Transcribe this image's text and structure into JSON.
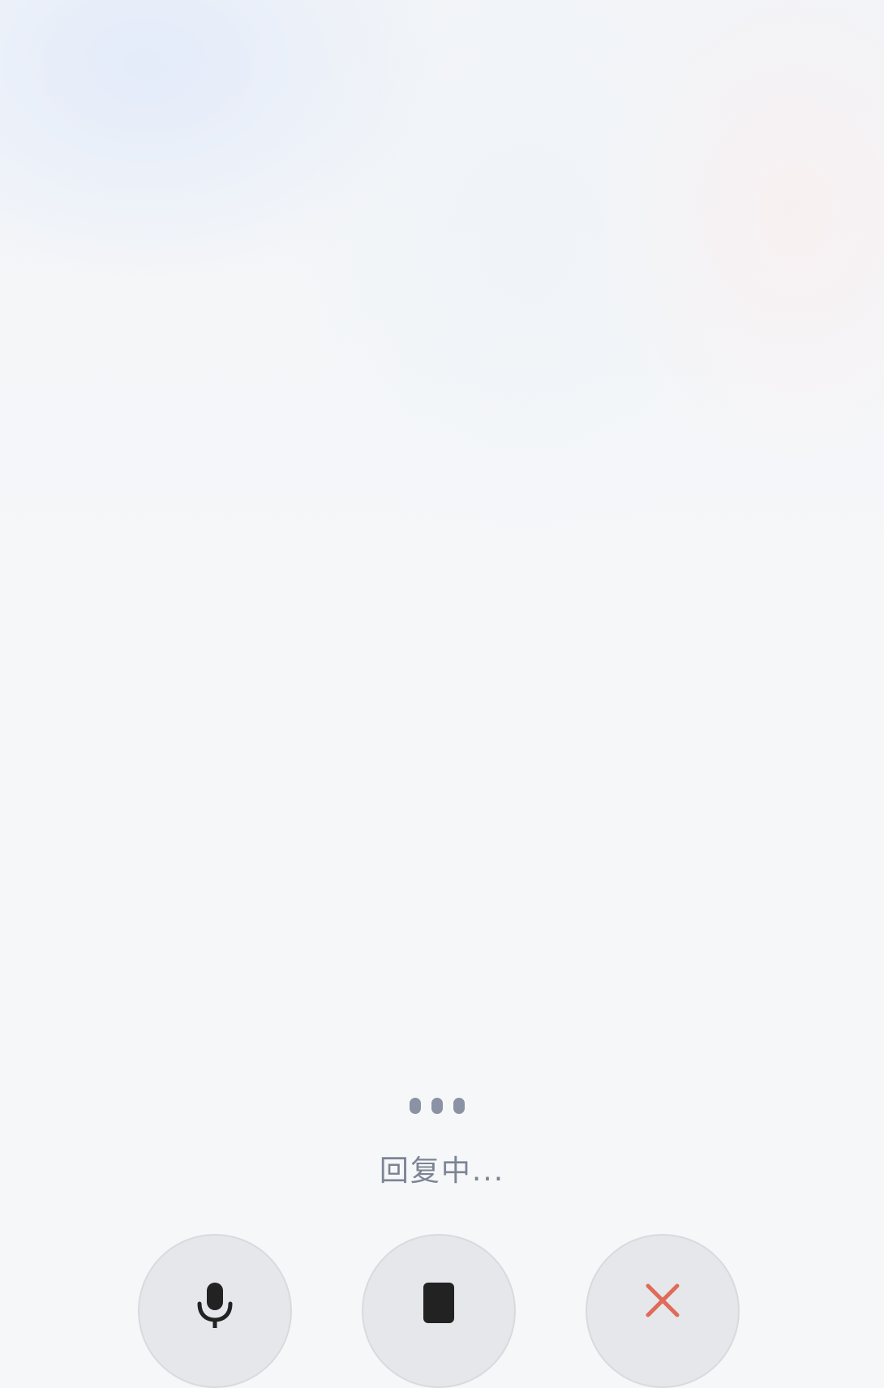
{
  "status": {
    "text": "回复中..."
  },
  "controls": {
    "mic_icon": "microphone-icon",
    "stop_icon": "stop-icon",
    "close_icon": "close-icon",
    "close_color": "#e06b5a"
  },
  "indicator": {
    "dots_count": 3
  }
}
